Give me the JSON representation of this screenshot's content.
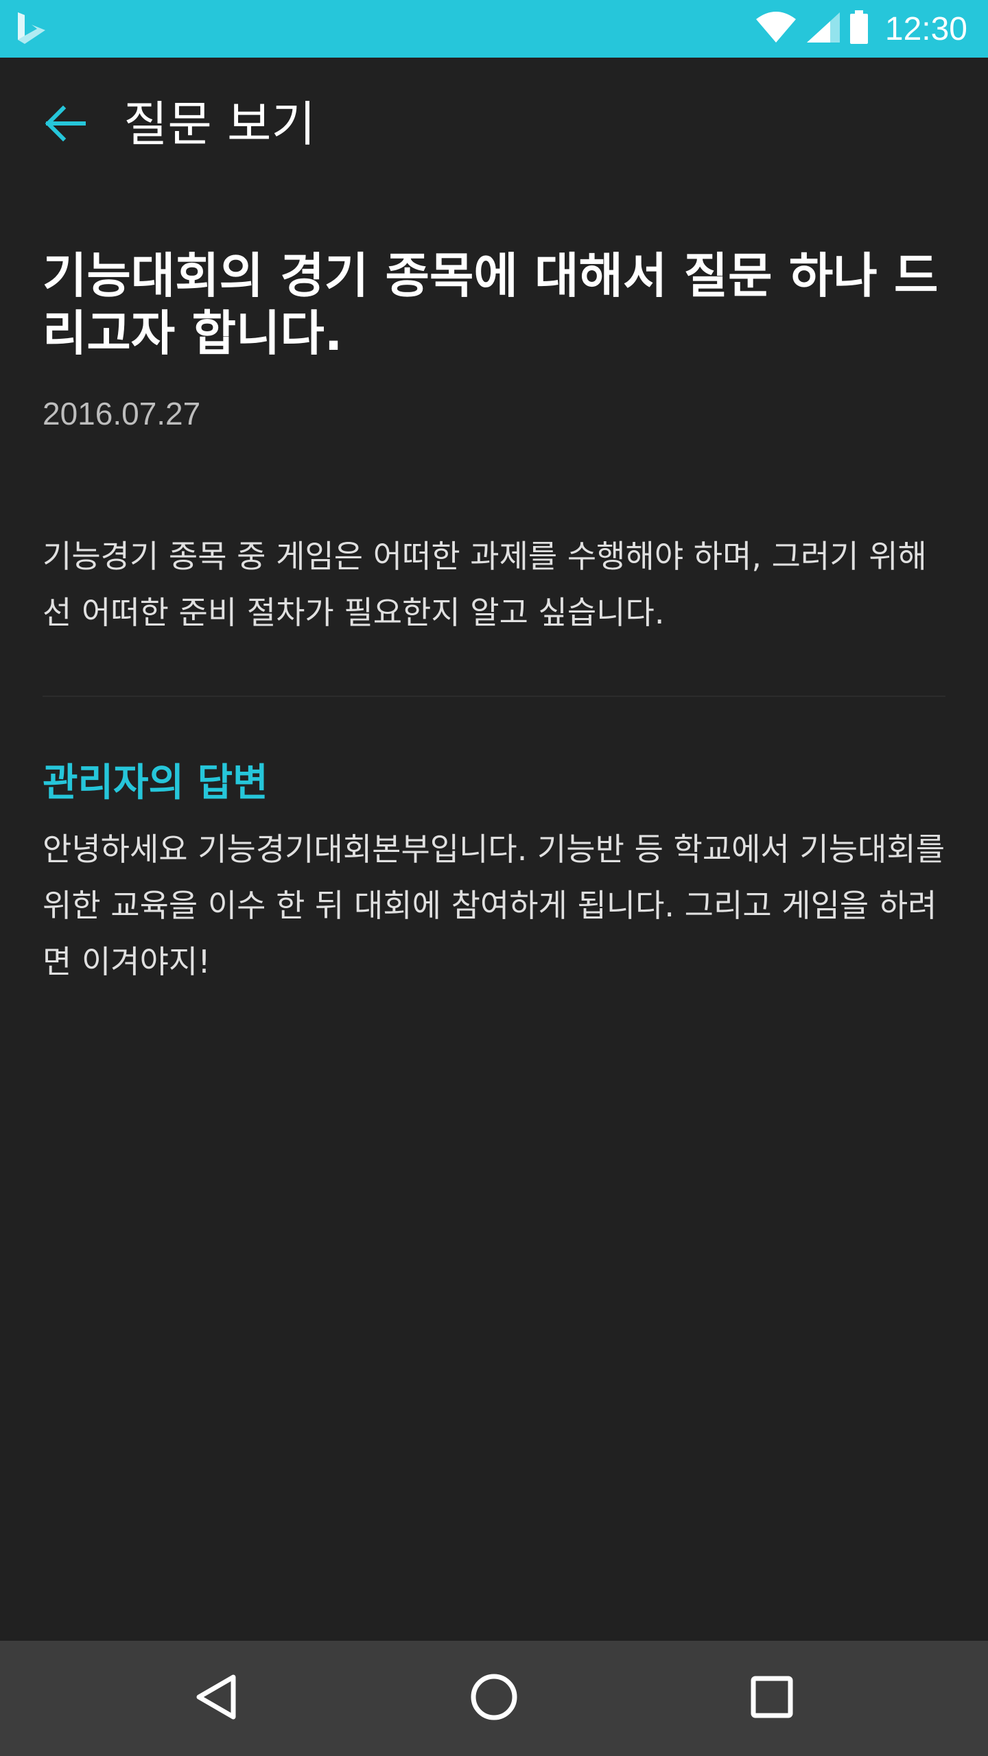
{
  "status_bar": {
    "time": "12:30",
    "icons": [
      "bing-logo-icon",
      "wifi-icon",
      "signal-icon",
      "battery-icon"
    ],
    "background": "#26c6da"
  },
  "app_bar": {
    "title": "질문 보기",
    "back_icon": "arrow-back-icon",
    "accent": "#26c6da"
  },
  "question": {
    "title": "기능대회의 경기 종목에 대해서 질문 하나 드리고자 합니다.",
    "date": "2016.07.27",
    "body": "기능경기 종목 중 게임은 어떠한 과제를 수행해야 하며, 그러기 위해선 어떠한 준비 절차가 필요한지 알고 싶습니다."
  },
  "answer": {
    "heading": "관리자의 답변",
    "body": "안녕하세요 기능경기대회본부입니다. 기능반 등 학교에서 기능대회를 위한 교육을 이수 한 뒤 대회에 참여하게 됩니다. 그리고 게임을 하려면 이겨야지!"
  },
  "nav_bar": {
    "buttons": [
      "back-triangle-icon",
      "home-circle-icon",
      "recents-square-icon"
    ]
  }
}
